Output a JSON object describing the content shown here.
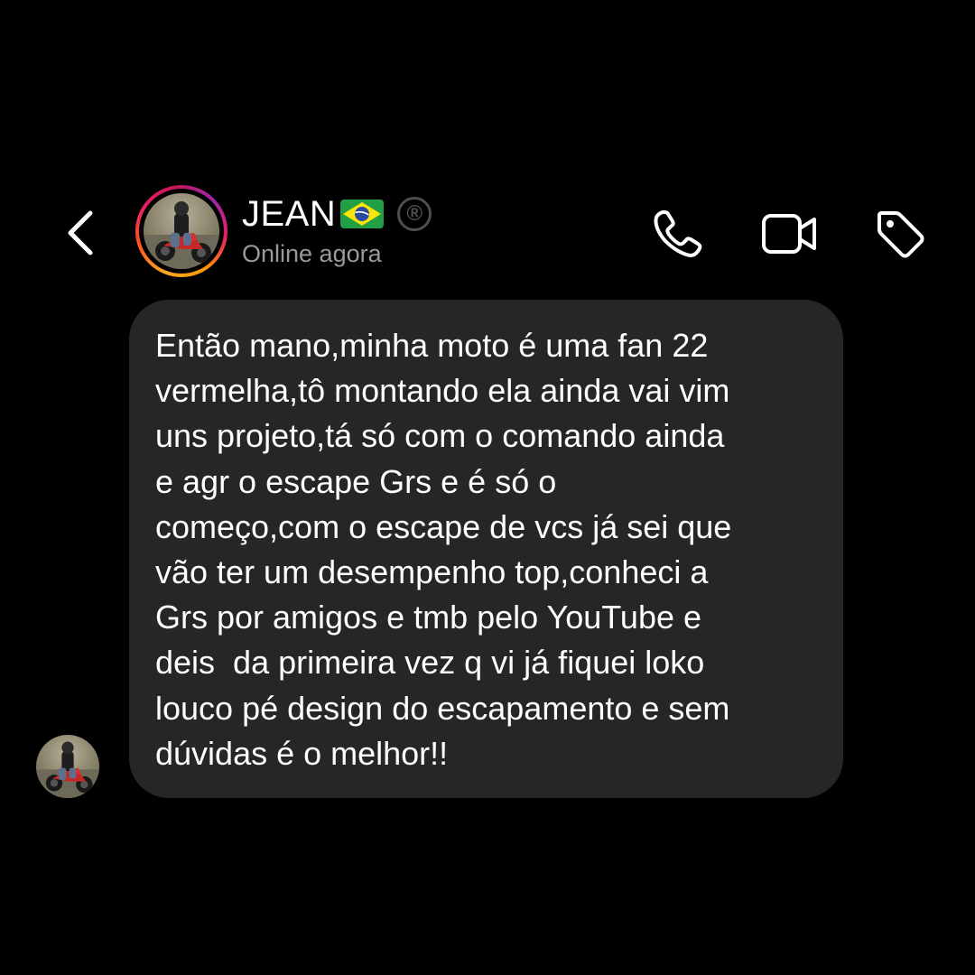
{
  "header": {
    "back_icon": "chevron-left-icon",
    "contact_name": "JEAN",
    "flag": "brazil-flag-icon",
    "registered_mark": "®",
    "status": "Online agora",
    "actions": [
      {
        "icon": "phone-icon",
        "label": "call"
      },
      {
        "icon": "video-camera-icon",
        "label": "video"
      },
      {
        "icon": "tag-icon",
        "label": "tag"
      }
    ]
  },
  "message": {
    "lines": [
      "Então mano,minha moto é uma fan 22",
      "vermelha,tô montando ela ainda vai vim",
      "uns projeto,tá só com o comando ainda",
      "e agr o escape Grs e é só o",
      "começo,com o escape de vcs já sei que",
      "vão ter um desempenho top,conheci a",
      "Grs por amigos e tmb pelo YouTube e",
      "deis  da primeira vez q vi já fiquei loko",
      "louco pé design do escapamento e sem",
      "dúvidas é o melhor!!"
    ]
  },
  "colors": {
    "background": "#000000",
    "bubble": "#262626",
    "text": "#ffffff",
    "status_text": "#9a9a9a",
    "story_ring": [
      "#f9a825",
      "#e91e63",
      "#9c27b0"
    ],
    "registered_mark": "#4e4e4e"
  }
}
